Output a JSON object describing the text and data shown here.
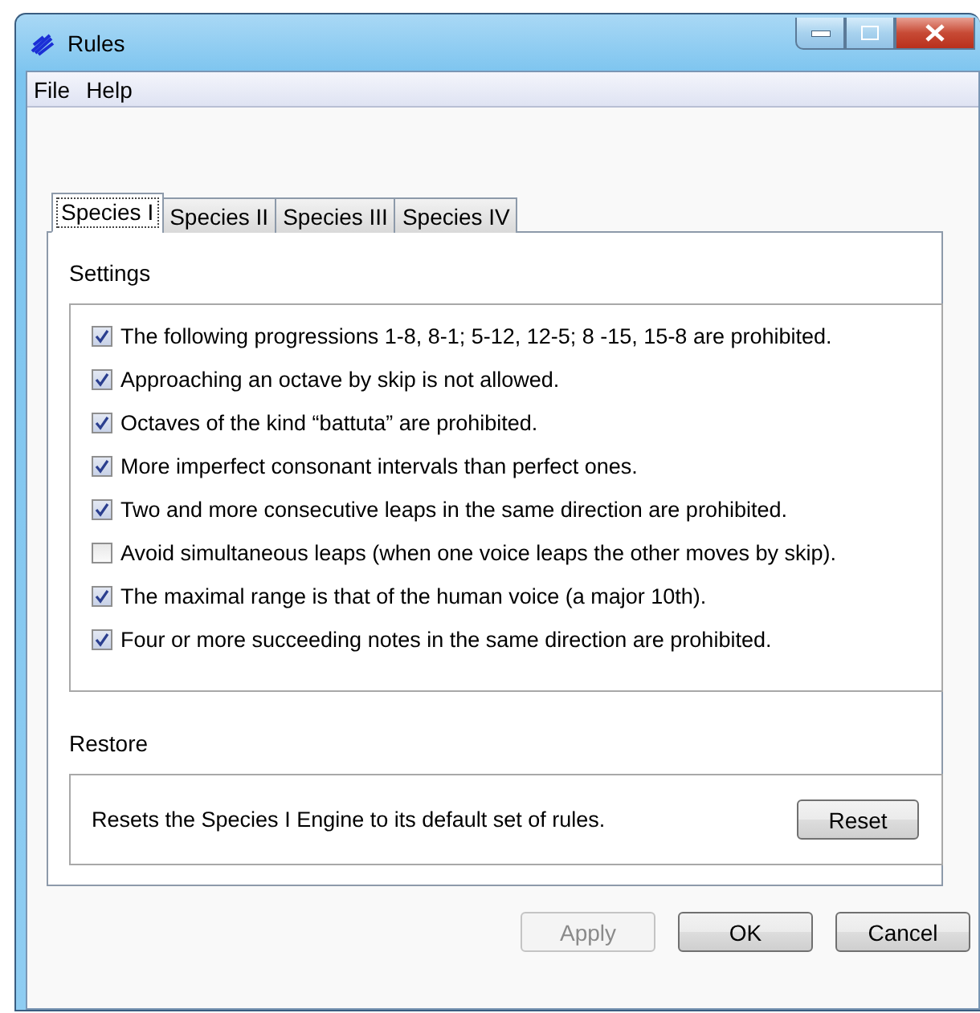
{
  "window": {
    "title": "Rules"
  },
  "menu": [
    "File",
    "Help"
  ],
  "tabs": [
    {
      "label": "Species I",
      "selected": true
    },
    {
      "label": "Species II",
      "selected": false
    },
    {
      "label": "Species III",
      "selected": false
    },
    {
      "label": "Species IV",
      "selected": false
    }
  ],
  "settings": {
    "title": "Settings",
    "rules": [
      {
        "label": "The following progressions 1-8, 8-1; 5-12, 12-5; 8 -15, 15-8 are prohibited.",
        "checked": true
      },
      {
        "label": "Approaching an octave by skip is not allowed.",
        "checked": true
      },
      {
        "label": "Octaves of the kind “battuta” are prohibited.",
        "checked": true
      },
      {
        "label": "More imperfect consonant intervals than perfect ones.",
        "checked": true
      },
      {
        "label": "Two and more consecutive leaps in the same direction are prohibited.",
        "checked": true
      },
      {
        "label": "Avoid simultaneous leaps (when one voice leaps the other moves by skip).",
        "checked": false
      },
      {
        "label": "The maximal range is that of the human voice (a major 10th).",
        "checked": true
      },
      {
        "label": "Four or more succeeding notes in the same direction are prohibited.",
        "checked": true
      }
    ]
  },
  "restore": {
    "title": "Restore",
    "text": "Resets the Species I Engine to its default set of rules.",
    "button": "Reset"
  },
  "buttons": [
    {
      "label": "Apply",
      "disabled": true
    },
    {
      "label": "OK",
      "disabled": false
    },
    {
      "label": "Cancel",
      "disabled": false
    }
  ]
}
